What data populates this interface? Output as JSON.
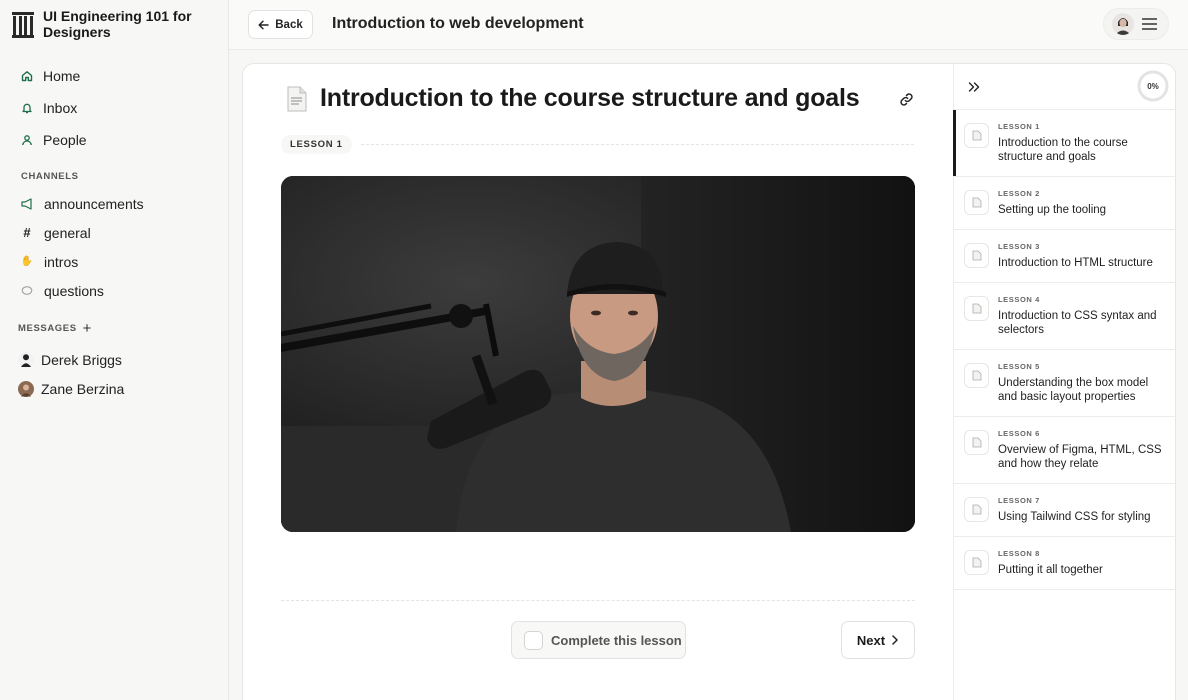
{
  "brand": {
    "title": "UI Engineering 101 for Designers"
  },
  "nav": [
    {
      "label": "Home",
      "icon": "home-icon"
    },
    {
      "label": "Inbox",
      "icon": "bell-icon"
    },
    {
      "label": "People",
      "icon": "person-icon"
    }
  ],
  "channels": {
    "label": "CHANNELS",
    "items": [
      {
        "label": "announcements",
        "icon": "megaphone-icon"
      },
      {
        "label": "general",
        "icon": "hash-icon"
      },
      {
        "label": "intros",
        "icon": "wave-hand-icon"
      },
      {
        "label": "questions",
        "icon": "speech-bubble-icon"
      }
    ]
  },
  "messages": {
    "label": "MESSAGES",
    "items": [
      {
        "label": "Derek Briggs"
      },
      {
        "label": "Zane Berzina"
      }
    ]
  },
  "topbar": {
    "back_label": "Back",
    "course_title": "Introduction to web development"
  },
  "lesson": {
    "title": "Introduction to the course structure and goals",
    "tag": "LESSON 1",
    "complete_label": "Complete this lesson",
    "next_label": "Next"
  },
  "progress": {
    "value": 0,
    "label": "0%"
  },
  "lessons": [
    {
      "num": "LESSON 1",
      "title": "Introduction to the course structure and goals",
      "active": true
    },
    {
      "num": "LESSON 2",
      "title": "Setting up the tooling"
    },
    {
      "num": "LESSON 3",
      "title": "Introduction to HTML structure"
    },
    {
      "num": "LESSON 4",
      "title": "Introduction to CSS syntax and selectors"
    },
    {
      "num": "LESSON 5",
      "title": "Understanding the box model and basic layout properties"
    },
    {
      "num": "LESSON 6",
      "title": "Overview of Figma, HTML, CSS and how they relate"
    },
    {
      "num": "LESSON 7",
      "title": "Using Tailwind CSS for styling"
    },
    {
      "num": "LESSON 8",
      "title": "Putting it all together"
    }
  ],
  "colors": {
    "accent": "#1a1a1a",
    "sidebar_icon": "#1f6f4a"
  }
}
